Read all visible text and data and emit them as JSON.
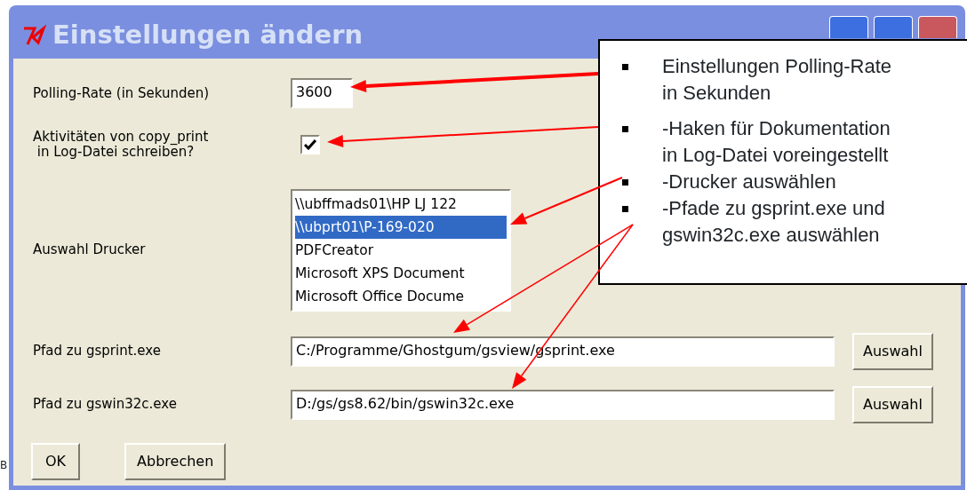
{
  "window": {
    "title": "Einstellungen ändern"
  },
  "polling": {
    "label": "Polling-Rate (in Sekunden)",
    "value": "3600"
  },
  "log": {
    "label_lines": [
      "Aktivitäten von copy_print",
      "in Log-Datei schreiben?"
    ],
    "checked": true
  },
  "printer": {
    "label": "Auswahl Drucker",
    "items": [
      {
        "text": "\\\\ubffmads01\\HP LJ 122",
        "selected": false
      },
      {
        "text": "\\\\ubprt01\\P-169-020",
        "selected": true
      },
      {
        "text": "PDFCreator",
        "selected": false
      },
      {
        "text": "Microsoft XPS Document",
        "selected": false
      },
      {
        "text": "Microsoft Office Docume",
        "selected": false
      }
    ]
  },
  "paths": [
    {
      "label": "Pfad zu gsprint.exe",
      "value": "C:/Programme/Ghostgum/gsview/gsprint.exe",
      "button": "Auswahl"
    },
    {
      "label": "Pfad zu gswin32c.exe",
      "value": "D:/gs/gs8.62/bin/gswin32c.exe",
      "button": "Auswahl"
    }
  ],
  "buttons": [
    "OK",
    "Abbrechen"
  ],
  "edge_text": "B",
  "callout": {
    "items": [
      {
        "lines": [
          "Einstellungen Polling-Rate",
          "in Sekunden"
        ]
      },
      {
        "lines": [
          "-Haken für Dokumentation",
          "in Log-Datei voreingestellt"
        ]
      },
      {
        "lines": [
          "-Drucker auswählen"
        ]
      },
      {
        "lines": [
          "-Pfade zu gsprint.exe und",
          "gswin32c.exe auswählen"
        ]
      }
    ]
  }
}
